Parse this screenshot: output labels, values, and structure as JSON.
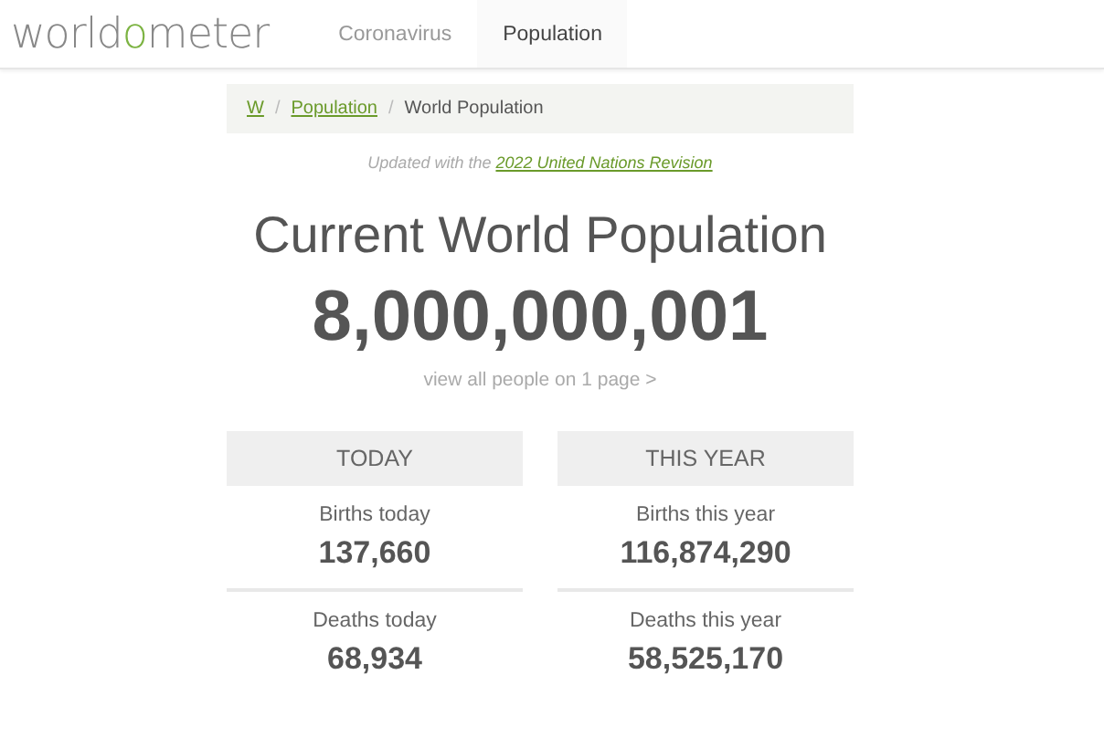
{
  "header": {
    "logo": {
      "before": "world",
      "highlight": "o",
      "after": "meter"
    },
    "nav": [
      {
        "label": "Coronavirus",
        "selected": false
      },
      {
        "label": "Population",
        "selected": true
      }
    ]
  },
  "breadcrumb": {
    "items": [
      {
        "label": "W",
        "link": true
      },
      {
        "label": "Population",
        "link": true
      },
      {
        "label": "World Population",
        "link": false
      }
    ],
    "separators": [
      "/",
      "/"
    ]
  },
  "update_note": {
    "text": "Updated with the",
    "link": "2022 United Nations Revision"
  },
  "title": "Current World Population",
  "population": "8,000,000,001",
  "view_all": "view all people on 1 page >",
  "columns": [
    {
      "heading": "TODAY",
      "stats": [
        {
          "label": "Births today",
          "value": "137,660"
        },
        {
          "label": "Deaths today",
          "value": "68,934"
        }
      ]
    },
    {
      "heading": "THIS YEAR",
      "stats": [
        {
          "label": "Births this year",
          "value": "116,874,290"
        },
        {
          "label": "Deaths this year",
          "value": "58,525,170"
        }
      ]
    }
  ]
}
